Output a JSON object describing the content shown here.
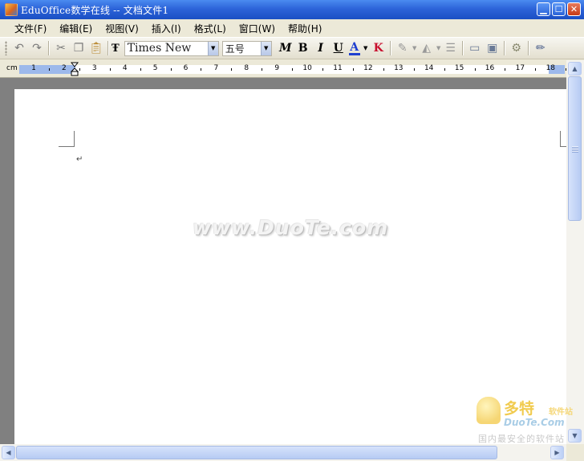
{
  "window": {
    "title": "EduOffice数学在线 -- 文档文件1"
  },
  "menu": [
    "文件(F)",
    "编辑(E)",
    "视图(V)",
    "插入(I)",
    "格式(L)",
    "窗口(W)",
    "帮助(H)"
  ],
  "toolbar": {
    "font_name": "Times New",
    "font_size": "五号",
    "bold_label": "B",
    "italic_label": "I",
    "underline_label": "U",
    "math_label": "M",
    "font_color_label": "A",
    "clear_format_label": "K",
    "font_color": "#1F3FD0",
    "clear_color": "#C8102E"
  },
  "ruler": {
    "unit": "cm",
    "ticks": [
      "1",
      "2",
      "3",
      "4",
      "5",
      "6",
      "7",
      "8",
      "9",
      "10",
      "11",
      "12",
      "13",
      "14",
      "15",
      "16",
      "17",
      "18"
    ]
  },
  "document": {
    "paragraph_mark": "↵",
    "watermark": "www.DuoTe.com"
  },
  "logo": {
    "main": "多特",
    "sub": "软件站",
    "url": "DuoTe.Com",
    "slogan": "国内最安全的软件站"
  }
}
